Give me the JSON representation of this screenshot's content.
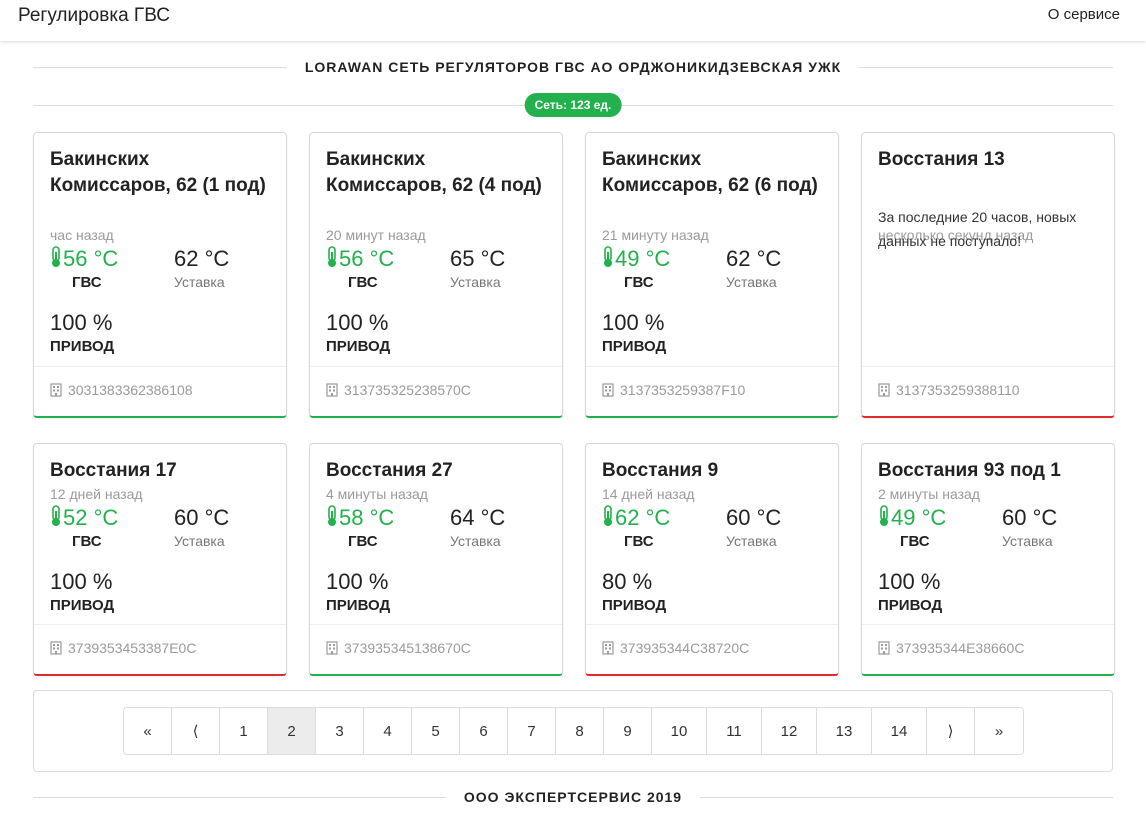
{
  "navbar": {
    "brand": "Регулировка ГВС",
    "about": "О сервисе"
  },
  "header": {
    "title": "LORAWAN СЕТЬ РЕГУЛЯТОРОВ ГВС АО ОРДЖОНИКИДЗЕВСКАЯ УЖК",
    "network_badge": "Сеть: 123 ед."
  },
  "labels": {
    "gvs": "ГВС",
    "setpoint": "Уставка",
    "drive": "ПРИВОД"
  },
  "colors": {
    "ok": "#22b14c",
    "bad": "#e02b2b"
  },
  "cards": [
    {
      "title": "Бакинских Комиссаров, 62 (1 под)",
      "ago": "час назад",
      "temp": "56 °C",
      "setpoint": "62 °C",
      "drive": "100 %",
      "device": "3031383362386108",
      "status": "ok"
    },
    {
      "title": "Бакинских Комиссаров, 62 (4 под)",
      "ago": "20 минут назад",
      "temp": "56 °C",
      "setpoint": "65 °C",
      "drive": "100 %",
      "device": "313735325238570C",
      "status": "ok"
    },
    {
      "title": "Бакинских Комиссаров, 62 (6 под)",
      "ago": "21 минуту назад",
      "temp": "49 °C",
      "setpoint": "62 °C",
      "drive": "100 %",
      "device": "3137353259387F10",
      "status": "ok"
    },
    {
      "title": "Восстания 13",
      "ago": "несколько секунд назад",
      "message": "За последние 20 часов, новых данных не поступало!",
      "device": "3137353259388110",
      "status": "bad"
    },
    {
      "title": "Восстания 17",
      "ago": "12 дней назад",
      "temp": "52 °C",
      "setpoint": "60 °C",
      "drive": "100 %",
      "device": "3739353453387E0C",
      "status": "bad"
    },
    {
      "title": "Восстания 27",
      "ago": "4 минуты назад",
      "temp": "58 °C",
      "setpoint": "64 °C",
      "drive": "100 %",
      "device": "373935345138670C",
      "status": "ok"
    },
    {
      "title": "Восстания 9",
      "ago": "14 дней назад",
      "temp": "62 °C",
      "setpoint": "60 °C",
      "drive": "80 %",
      "device": "373935344C38720C",
      "status": "bad"
    },
    {
      "title": "Восстания 93 под 1",
      "ago": "2 минуты назад",
      "temp": "49 °C",
      "setpoint": "60 °C",
      "drive": "100 %",
      "device": "373935344E38660C",
      "status": "ok"
    }
  ],
  "pagination": {
    "items": [
      "«",
      "⟨",
      "1",
      "2",
      "3",
      "4",
      "5",
      "6",
      "7",
      "8",
      "9",
      "10",
      "11",
      "12",
      "13",
      "14",
      "⟩",
      "»"
    ],
    "active": "2"
  },
  "footer": {
    "text": "ООО ЭКСПЕРТСЕРВИС 2019"
  }
}
